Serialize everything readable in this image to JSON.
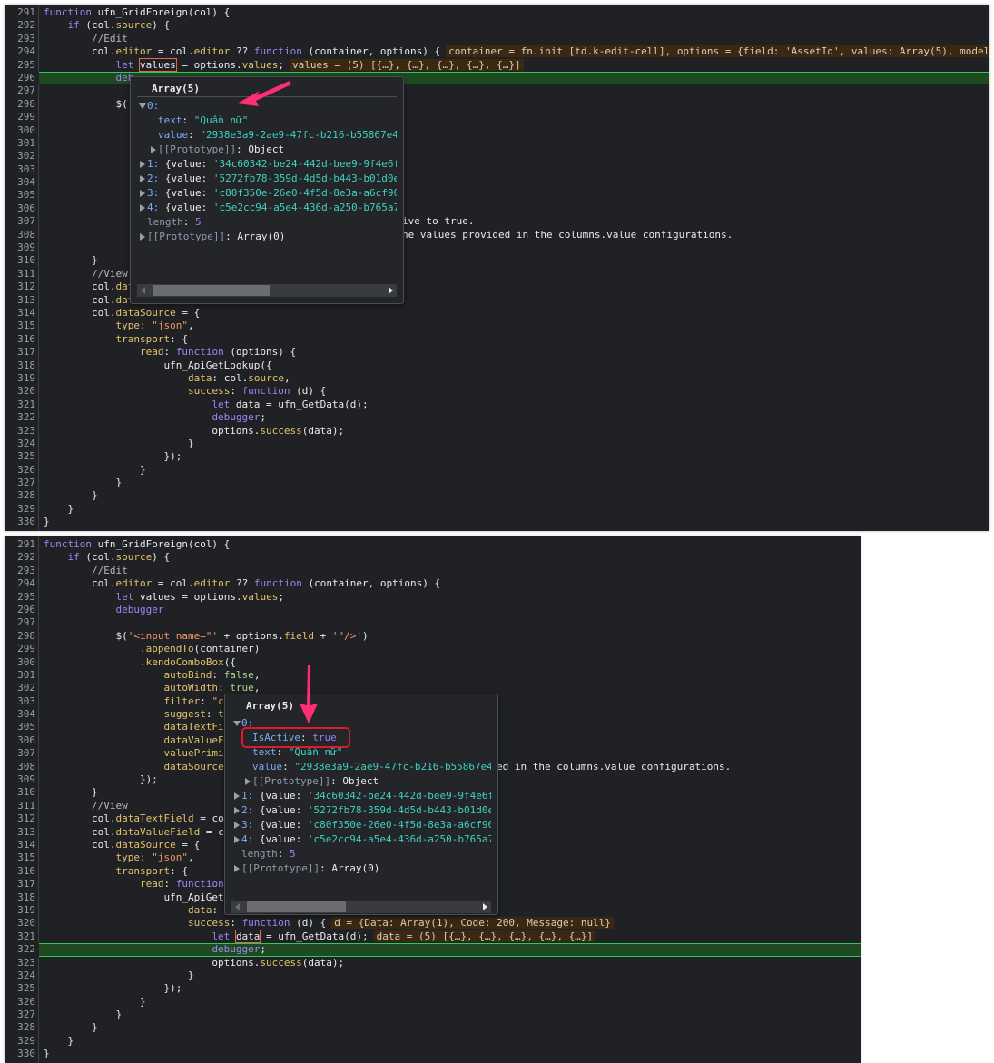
{
  "colors": {
    "arrow": "#ff2d72",
    "exec_line": "#1e4a22",
    "highlight_box": "#e0192a"
  },
  "top_panel": {
    "lines": [
      {
        "n": "291",
        "tk": [
          [
            "k",
            "function"
          ],
          [
            "t",
            " ufn_GridForeign(col) {"
          ]
        ]
      },
      {
        "n": "292",
        "tk": [
          [
            "t",
            "    "
          ],
          [
            "k",
            "if"
          ],
          [
            "t",
            " (col."
          ],
          [
            "p",
            "source"
          ],
          [
            "t",
            ") {"
          ]
        ]
      },
      {
        "n": "293",
        "tk": [
          [
            "c",
            "        //Edit"
          ]
        ]
      },
      {
        "n": "294",
        "tk": [
          [
            "t",
            "        col."
          ],
          [
            "p",
            "editor"
          ],
          [
            "t",
            " = col."
          ],
          [
            "p",
            "editor"
          ],
          [
            "t",
            " ?? "
          ],
          [
            "k",
            "function"
          ],
          [
            "t",
            " (container, options) {"
          ]
        ],
        "inline": "container = fn.init [td.k-edit-cell], options = {field: 'AssetId', values: Array(5), model"
      },
      {
        "n": "295",
        "tk": [
          [
            "t",
            "            "
          ],
          [
            "k",
            "let"
          ],
          [
            "t",
            " "
          ],
          [
            "hl",
            "values"
          ],
          [
            "t",
            " = options."
          ],
          [
            "p",
            "values"
          ],
          [
            "t",
            ";"
          ]
        ],
        "inline": "values = (5) [{…}, {…}, {…}, {…}, {…}]"
      },
      {
        "n": "296",
        "exec": true,
        "tk": [
          [
            "t",
            "            "
          ],
          [
            "k",
            "deb"
          ]
        ]
      },
      {
        "n": "297",
        "tk": []
      },
      {
        "n": "298",
        "tk": [
          [
            "t",
            "            $("
          ]
        ]
      },
      {
        "n": "299",
        "tk": []
      },
      {
        "n": "300",
        "tk": []
      },
      {
        "n": "301",
        "tk": []
      },
      {
        "n": "302",
        "tk": []
      },
      {
        "n": "303",
        "tk": []
      },
      {
        "n": "304",
        "tk": []
      },
      {
        "n": "305",
        "tk": []
      },
      {
        "n": "306",
        "tk": []
      },
      {
        "n": "307",
        "tk": [],
        "tail": "ive to true."
      },
      {
        "n": "308",
        "tk": [],
        "tail": "he values provided in the columns.value configurations."
      },
      {
        "n": "309",
        "tk": []
      },
      {
        "n": "310",
        "tk": [
          [
            "t",
            "        }"
          ]
        ]
      },
      {
        "n": "311",
        "tk": [
          [
            "c",
            "        //View"
          ]
        ]
      },
      {
        "n": "312",
        "tk": [
          [
            "t",
            "        col."
          ],
          [
            "p",
            "dat"
          ]
        ]
      },
      {
        "n": "313",
        "tk": [
          [
            "t",
            "        col."
          ],
          [
            "p",
            "dat"
          ]
        ]
      },
      {
        "n": "314",
        "tk": [
          [
            "t",
            "        col."
          ],
          [
            "p",
            "dataSource"
          ],
          [
            "t",
            " = {"
          ]
        ]
      },
      {
        "n": "315",
        "tk": [
          [
            "t",
            "            "
          ],
          [
            "p",
            "type"
          ],
          [
            "t",
            ": "
          ],
          [
            "s",
            "\"json\""
          ],
          [
            "t",
            ","
          ]
        ]
      },
      {
        "n": "316",
        "tk": [
          [
            "t",
            "            "
          ],
          [
            "p",
            "transport"
          ],
          [
            "t",
            ": {"
          ]
        ]
      },
      {
        "n": "317",
        "tk": [
          [
            "t",
            "                "
          ],
          [
            "p",
            "read"
          ],
          [
            "t",
            ": "
          ],
          [
            "k",
            "function"
          ],
          [
            "t",
            " (options) {"
          ]
        ]
      },
      {
        "n": "318",
        "tk": [
          [
            "t",
            "                    ufn_ApiGetLookup({"
          ]
        ]
      },
      {
        "n": "319",
        "tk": [
          [
            "t",
            "                        "
          ],
          [
            "p",
            "data"
          ],
          [
            "t",
            ": col."
          ],
          [
            "p",
            "source"
          ],
          [
            "t",
            ","
          ]
        ]
      },
      {
        "n": "320",
        "tk": [
          [
            "t",
            "                        "
          ],
          [
            "p",
            "success"
          ],
          [
            "t",
            ": "
          ],
          [
            "k",
            "function"
          ],
          [
            "t",
            " (d) {"
          ]
        ]
      },
      {
        "n": "321",
        "tk": [
          [
            "t",
            "                            "
          ],
          [
            "k",
            "let"
          ],
          [
            "t",
            " data = ufn_GetData(d);"
          ]
        ]
      },
      {
        "n": "322",
        "tk": [
          [
            "t",
            "                            "
          ],
          [
            "k",
            "debugger"
          ],
          [
            "t",
            ";"
          ]
        ]
      },
      {
        "n": "323",
        "tk": [
          [
            "t",
            "                            options."
          ],
          [
            "p",
            "success"
          ],
          [
            "t",
            "(data);"
          ]
        ]
      },
      {
        "n": "324",
        "tk": [
          [
            "t",
            "                        }"
          ]
        ]
      },
      {
        "n": "325",
        "tk": [
          [
            "t",
            "                    });"
          ]
        ]
      },
      {
        "n": "326",
        "tk": [
          [
            "t",
            "                }"
          ]
        ]
      },
      {
        "n": "327",
        "tk": [
          [
            "t",
            "            }"
          ]
        ]
      },
      {
        "n": "328",
        "tk": [
          [
            "t",
            "        }"
          ]
        ]
      },
      {
        "n": "329",
        "tk": [
          [
            "t",
            "    }"
          ]
        ]
      },
      {
        "n": "330",
        "tk": [
          [
            "t",
            "}"
          ]
        ]
      }
    ],
    "popup": {
      "title": "Array(5)",
      "item0_label": "0:",
      "item0_text_key": "text",
      "item0_text_val": "\"Quần nữ\"",
      "item0_value_key": "value",
      "item0_value_val": "\"2938e3a9-2ae9-47fc-b216-b55867e4",
      "item0_proto": "[[Prototype]]",
      "item0_proto_val": "Object",
      "items": [
        {
          "idx": "1:",
          "val": "'34c60342-be24-442d-bee9-9f4e6f"
        },
        {
          "idx": "2:",
          "val": "'5272fb78-359d-4d5d-b443-b01d0e"
        },
        {
          "idx": "3:",
          "val": "'c80f350e-26e0-4f5d-8e3a-a6cf90"
        },
        {
          "idx": "4:",
          "val": "'c5e2cc94-a5e4-436d-a250-b765a7"
        }
      ],
      "item_prefix": "{value: ",
      "length_key": "length",
      "length_val": "5",
      "proto": "[[Prototype]]",
      "proto_val": "Array(0)"
    }
  },
  "bottom_panel": {
    "lines": [
      {
        "n": "291",
        "tk": [
          [
            "k",
            "function"
          ],
          [
            "t",
            " ufn_GridForeign(col) {"
          ]
        ]
      },
      {
        "n": "292",
        "tk": [
          [
            "t",
            "    "
          ],
          [
            "k",
            "if"
          ],
          [
            "t",
            " (col."
          ],
          [
            "p",
            "source"
          ],
          [
            "t",
            ") {"
          ]
        ]
      },
      {
        "n": "293",
        "tk": [
          [
            "c",
            "        //Edit"
          ]
        ]
      },
      {
        "n": "294",
        "tk": [
          [
            "t",
            "        col."
          ],
          [
            "p",
            "editor"
          ],
          [
            "t",
            " = col."
          ],
          [
            "p",
            "editor"
          ],
          [
            "t",
            " ?? "
          ],
          [
            "k",
            "function"
          ],
          [
            "t",
            " (container, options) {"
          ]
        ]
      },
      {
        "n": "295",
        "tk": [
          [
            "t",
            "            "
          ],
          [
            "k",
            "let"
          ],
          [
            "t",
            " values = options."
          ],
          [
            "p",
            "values"
          ],
          [
            "t",
            ";"
          ]
        ]
      },
      {
        "n": "296",
        "tk": [
          [
            "t",
            "            "
          ],
          [
            "k",
            "debugger"
          ]
        ]
      },
      {
        "n": "297",
        "tk": []
      },
      {
        "n": "298",
        "tk": [
          [
            "t",
            "            $("
          ],
          [
            "s",
            "'<input name=\"'"
          ],
          [
            "t",
            " + options."
          ],
          [
            "p",
            "field"
          ],
          [
            "t",
            " + "
          ],
          [
            "s",
            "'\"/>'"
          ],
          [
            "t",
            ")"
          ]
        ]
      },
      {
        "n": "299",
        "tk": [
          [
            "t",
            "                ."
          ],
          [
            "p",
            "appendTo"
          ],
          [
            "t",
            "(container)"
          ]
        ]
      },
      {
        "n": "300",
        "tk": [
          [
            "t",
            "                ."
          ],
          [
            "p",
            "kendoComboBox"
          ],
          [
            "t",
            "({"
          ]
        ]
      },
      {
        "n": "301",
        "tk": [
          [
            "t",
            "                    "
          ],
          [
            "p",
            "autoBind"
          ],
          [
            "t",
            ": "
          ],
          [
            "b",
            "false"
          ],
          [
            "t",
            ","
          ]
        ]
      },
      {
        "n": "302",
        "tk": [
          [
            "t",
            "                    "
          ],
          [
            "p",
            "autoWidth"
          ],
          [
            "t",
            ": "
          ],
          [
            "b",
            "true"
          ],
          [
            "t",
            ","
          ]
        ]
      },
      {
        "n": "303",
        "tk": [
          [
            "t",
            "                    "
          ],
          [
            "p",
            "filter"
          ],
          [
            "t",
            ": "
          ],
          [
            "s",
            "\"c"
          ]
        ]
      },
      {
        "n": "304",
        "tk": [
          [
            "t",
            "                    "
          ],
          [
            "p",
            "suggest"
          ],
          [
            "t",
            ": "
          ],
          [
            "b",
            "t"
          ]
        ]
      },
      {
        "n": "305",
        "tk": [
          [
            "t",
            "                    "
          ],
          [
            "p",
            "dataTextFie"
          ]
        ]
      },
      {
        "n": "306",
        "tk": [
          [
            "t",
            "                    "
          ],
          [
            "p",
            "dataValueFi"
          ]
        ]
      },
      {
        "n": "307",
        "tk": [
          [
            "t",
            "                    "
          ],
          [
            "p",
            "valuePrimit"
          ]
        ]
      },
      {
        "n": "308",
        "tk": [
          [
            "t",
            "                    "
          ],
          [
            "p",
            "dataSource"
          ],
          [
            "t",
            ":"
          ]
        ],
        "tail": "ed in the columns.value configurations."
      },
      {
        "n": "309",
        "tk": [
          [
            "t",
            "                });"
          ]
        ]
      },
      {
        "n": "310",
        "tk": [
          [
            "t",
            "        }"
          ]
        ]
      },
      {
        "n": "311",
        "tk": [
          [
            "c",
            "        //View"
          ]
        ]
      },
      {
        "n": "312",
        "tk": [
          [
            "t",
            "        col."
          ],
          [
            "p",
            "dataTextField"
          ],
          [
            "t",
            " = col"
          ]
        ]
      },
      {
        "n": "313",
        "tk": [
          [
            "t",
            "        col."
          ],
          [
            "p",
            "dataValueField"
          ],
          [
            "t",
            " = cc"
          ]
        ]
      },
      {
        "n": "314",
        "tk": [
          [
            "t",
            "        col."
          ],
          [
            "p",
            "dataSource"
          ],
          [
            "t",
            " = {"
          ]
        ]
      },
      {
        "n": "315",
        "tk": [
          [
            "t",
            "            "
          ],
          [
            "p",
            "type"
          ],
          [
            "t",
            ": "
          ],
          [
            "s",
            "\"json\""
          ],
          [
            "t",
            ","
          ]
        ]
      },
      {
        "n": "316",
        "tk": [
          [
            "t",
            "            "
          ],
          [
            "p",
            "transport"
          ],
          [
            "t",
            ": {"
          ]
        ]
      },
      {
        "n": "317",
        "tk": [
          [
            "t",
            "                "
          ],
          [
            "p",
            "read"
          ],
          [
            "t",
            ": "
          ],
          [
            "k",
            "function"
          ]
        ]
      },
      {
        "n": "318",
        "tk": [
          [
            "t",
            "                    ufn_ApiGetl"
          ]
        ]
      },
      {
        "n": "319",
        "tk": [
          [
            "t",
            "                        "
          ],
          [
            "p",
            "data"
          ],
          [
            "t",
            ": c"
          ]
        ]
      },
      {
        "n": "320",
        "tk": [
          [
            "t",
            "                        "
          ],
          [
            "p",
            "success"
          ],
          [
            "t",
            ": "
          ],
          [
            "k",
            "function"
          ],
          [
            "t",
            " (d) {"
          ]
        ],
        "inline": "d = {Data: Array(1), Code: 200, Message: null}"
      },
      {
        "n": "321",
        "tk": [
          [
            "t",
            "                            "
          ],
          [
            "k",
            "let"
          ],
          [
            "t",
            " "
          ],
          [
            "hl",
            "data"
          ],
          [
            "t",
            " = ufn_GetData(d);"
          ]
        ],
        "inline": "data = (5) [{…}, {…}, {…}, {…}, {…}]"
      },
      {
        "n": "322",
        "exec": true,
        "tk": [
          [
            "t",
            "                            "
          ],
          [
            "k",
            "debugger"
          ],
          [
            "t",
            ";"
          ]
        ]
      },
      {
        "n": "323",
        "tk": [
          [
            "t",
            "                            options."
          ],
          [
            "p",
            "success"
          ],
          [
            "t",
            "(data);"
          ]
        ]
      },
      {
        "n": "324",
        "tk": [
          [
            "t",
            "                        }"
          ]
        ]
      },
      {
        "n": "325",
        "tk": [
          [
            "t",
            "                    });"
          ]
        ]
      },
      {
        "n": "326",
        "tk": [
          [
            "t",
            "                }"
          ]
        ]
      },
      {
        "n": "327",
        "tk": [
          [
            "t",
            "            }"
          ]
        ]
      },
      {
        "n": "328",
        "tk": [
          [
            "t",
            "        }"
          ]
        ]
      },
      {
        "n": "329",
        "tk": [
          [
            "t",
            "    }"
          ]
        ]
      },
      {
        "n": "330",
        "tk": [
          [
            "t",
            "}"
          ]
        ]
      }
    ],
    "popup": {
      "title": "Array(5)",
      "item0_label": "0:",
      "item0_active_key": "IsActive",
      "item0_active_val": "true",
      "item0_text_key": "text",
      "item0_text_val": "\"Quần nữ\"",
      "item0_value_key": "value",
      "item0_value_val": "\"2938e3a9-2ae9-47fc-b216-b55867e4",
      "item0_proto": "[[Prototype]]",
      "item0_proto_val": "Object",
      "items": [
        {
          "idx": "1:",
          "val": "'34c60342-be24-442d-bee9-9f4e6f"
        },
        {
          "idx": "2:",
          "val": "'5272fb78-359d-4d5d-b443-b01d0e"
        },
        {
          "idx": "3:",
          "val": "'c80f350e-26e0-4f5d-8e3a-a6cf90"
        },
        {
          "idx": "4:",
          "val": "'c5e2cc94-a5e4-436d-a250-b765a7"
        }
      ],
      "item_prefix": "{value: ",
      "length_key": "length",
      "length_val": "5",
      "proto": "[[Prototype]]",
      "proto_val": "Array(0)"
    }
  }
}
